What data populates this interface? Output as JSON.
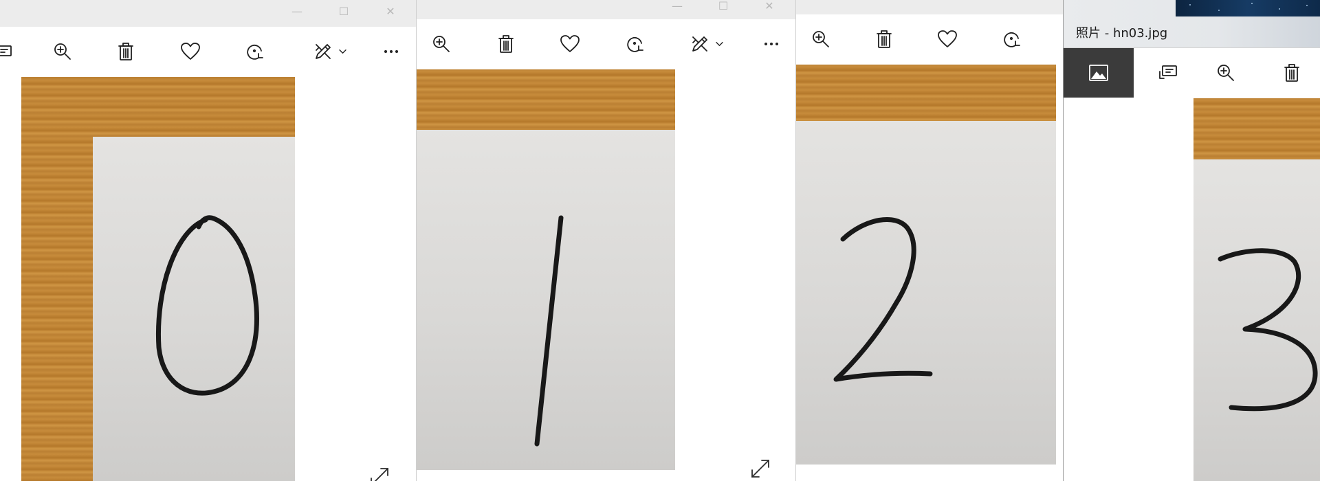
{
  "windows": [
    {
      "id": "a",
      "digit": "0"
    },
    {
      "id": "b",
      "digit": "1"
    },
    {
      "id": "c",
      "digit": "2"
    },
    {
      "id": "d",
      "title": "照片 - hn03.jpg",
      "digit": "3"
    }
  ],
  "caption_buttons": {
    "minimize": "—",
    "maximize": "☐",
    "close": "✕"
  },
  "toolbar_icons": [
    "slideshow-icon",
    "zoom-in-icon",
    "delete-icon",
    "favorite-heart-icon",
    "rotate-icon",
    "edit-create-icon",
    "chevron-down-icon",
    "more-options-icon"
  ],
  "colors": {
    "titlebar": "#ececec",
    "active_button": "#3b3b3b",
    "wood": "#c08234",
    "paper": "#dcdbd9"
  }
}
